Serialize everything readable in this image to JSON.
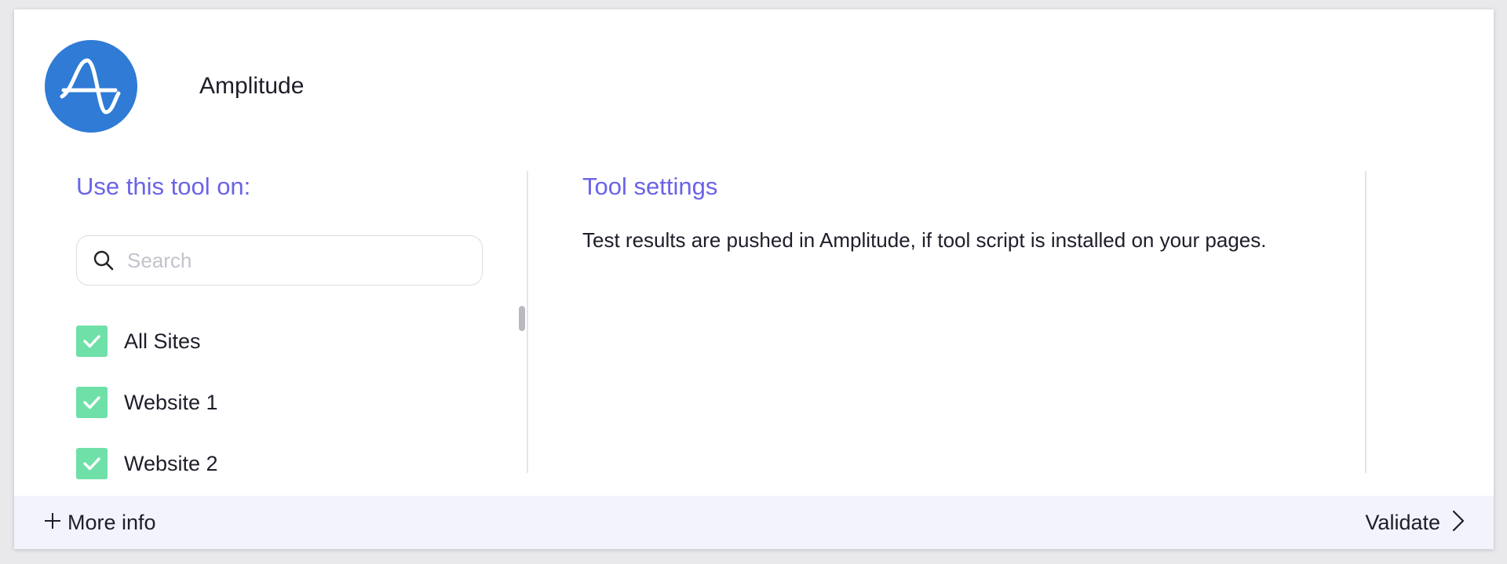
{
  "tool": {
    "name": "Amplitude",
    "logo_icon": "amplitude-logo-icon",
    "logo_color": "#2f7bd6"
  },
  "left_panel": {
    "title": "Use this tool on:",
    "search": {
      "placeholder": "Search",
      "value": ""
    },
    "sites": [
      {
        "label": "All Sites",
        "checked": true
      },
      {
        "label": "Website 1",
        "checked": true
      },
      {
        "label": "Website 2",
        "checked": true
      }
    ]
  },
  "right_panel": {
    "title": "Tool settings",
    "description": "Test results are pushed in Amplitude, if tool script is installed on your pages."
  },
  "footer": {
    "more_info_label": "More info",
    "validate_label": "Validate"
  },
  "colors": {
    "accent": "#6a63e8",
    "checkbox": "#6fe0a8",
    "footer_bg": "#f2f3fc"
  }
}
